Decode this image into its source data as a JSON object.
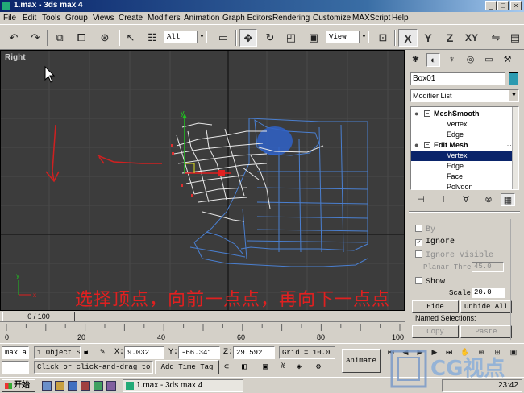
{
  "window": {
    "title": "1.max - 3ds max 4",
    "buttons": {
      "minimize": "_",
      "maximize": "□",
      "close": "×"
    }
  },
  "menu": {
    "items": [
      "File",
      "Edit",
      "Tools",
      "Group",
      "Views",
      "Create",
      "Modifiers",
      "Animation",
      "Graph Editors",
      "Rendering",
      "Customize",
      "MAXScript",
      "Help"
    ]
  },
  "toolbar": {
    "selection_filter": "All",
    "reference_coord": "View",
    "axis_x": "X",
    "axis_y": "Y",
    "axis_z": "Z",
    "axis_xy": "XY"
  },
  "viewport": {
    "label": "Right",
    "caption": "选择顶点，向前一点点，再向下一点点",
    "gizmo_y": "y",
    "axis_tripod": {
      "x": "x",
      "y": "y"
    }
  },
  "command_panel": {
    "object_name": "Box01",
    "object_color": "#2c9ab0",
    "modifier_list": "Modifier List",
    "stack": [
      {
        "label": "MeshSmooth",
        "type": "modifier"
      },
      {
        "label": "Vertex",
        "type": "sub"
      },
      {
        "label": "Edge",
        "type": "sub"
      },
      {
        "label": "Edit Mesh",
        "type": "modifier"
      },
      {
        "label": "Vertex",
        "type": "sub",
        "selected": true
      },
      {
        "label": "Edge",
        "type": "sub"
      },
      {
        "label": "Face",
        "type": "sub"
      },
      {
        "label": "Polygon",
        "type": "sub"
      }
    ],
    "rollout": {
      "by": "By",
      "ignore": "Ignore",
      "ignore_visible": "Ignore Visible",
      "planar_thresh_label": "Planar Thresh:",
      "planar_thresh_value": "45.0",
      "show": "Show",
      "scale_label": "Scale:",
      "scale_value": "20.0",
      "hide": "Hide",
      "unhide_all": "Unhide All",
      "named_selections": "Named Selections:",
      "copy": "Copy",
      "paste": "Paste"
    }
  },
  "timeline": {
    "frame_display": "0 / 100",
    "ticks": [
      "0",
      "20",
      "40",
      "60",
      "80",
      "100"
    ]
  },
  "status": {
    "maxscript_label": "max a",
    "selection": "1 Object S",
    "x_label": "X:",
    "x_value": "9.032",
    "y_label": "Y:",
    "y_value": "-66.341",
    "z_label": "Z:",
    "z_value": "29.592",
    "grid": "Grid = 10.0",
    "prompt": "Click or click-and-drag to",
    "add_time_tag": "Add Time Tag",
    "animate": "Animate"
  },
  "taskbar": {
    "start": "开始",
    "task": "1.max - 3ds max 4",
    "clock": "23:42"
  },
  "watermark": "CG视点"
}
